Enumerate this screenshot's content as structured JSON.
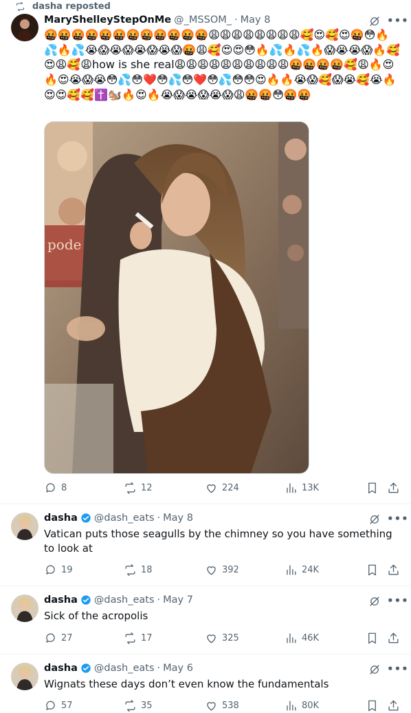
{
  "repost_label": "dasha reposted",
  "tweets": [
    {
      "name": "MaryShelleyStepOnMe",
      "handle": "@_MSSOM_",
      "date": "May 8",
      "verified": false,
      "emoji_before": "🤬🤬🤬🤬🤬🤬🤬🤬🤬🤬🤬🤬😩😩😩😩😩😩😩😩🥰😍🥰😍🤬😳🔥💦🔥💦😭😱😭😱😭😱😭😱🤬😩🥰😍😍😳🔥💦🔥💦🔥😱😭😭😱🔥🥰😍😩🥰😩",
      "text_inline": "how is she real",
      "emoji_after": "😩😩😩😩😩😩😩😩😩😩🤬🤬🤬🤬🥰😩🔥😍🔥😍😭😱😭😳💦😳❤️😳💦😳❤️😳💦😳😳😍🔥🔥😭😱🥰😱😭🥰😭🔥😍😍🥰🥰✝️🐿️🔥😍🔥😭😱😭😱😭😱😩🤬🤬😳🤬🤬",
      "replies": "8",
      "reposts": "12",
      "likes": "224",
      "views": "13K"
    },
    {
      "name": "dasha",
      "handle": "@dash_eats",
      "date": "May 8",
      "verified": true,
      "text": "Vatican puts those seagulls by the chimney so you have something to look at",
      "replies": "19",
      "reposts": "18",
      "likes": "392",
      "views": "24K"
    },
    {
      "name": "dasha",
      "handle": "@dash_eats",
      "date": "May 7",
      "verified": true,
      "text": "Sick of the acropolis",
      "replies": "27",
      "reposts": "17",
      "likes": "325",
      "views": "46K"
    },
    {
      "name": "dasha",
      "handle": "@dash_eats",
      "date": "May 6",
      "verified": true,
      "text": "Wignats these days don’t even know the fundamentals",
      "replies": "57",
      "reposts": "35",
      "likes": "538",
      "views": "80K"
    }
  ],
  "photo_sign_text": "pode",
  "colors": {
    "verified": "#1d9bf0",
    "muted": "#536471",
    "text": "#0f1419"
  }
}
